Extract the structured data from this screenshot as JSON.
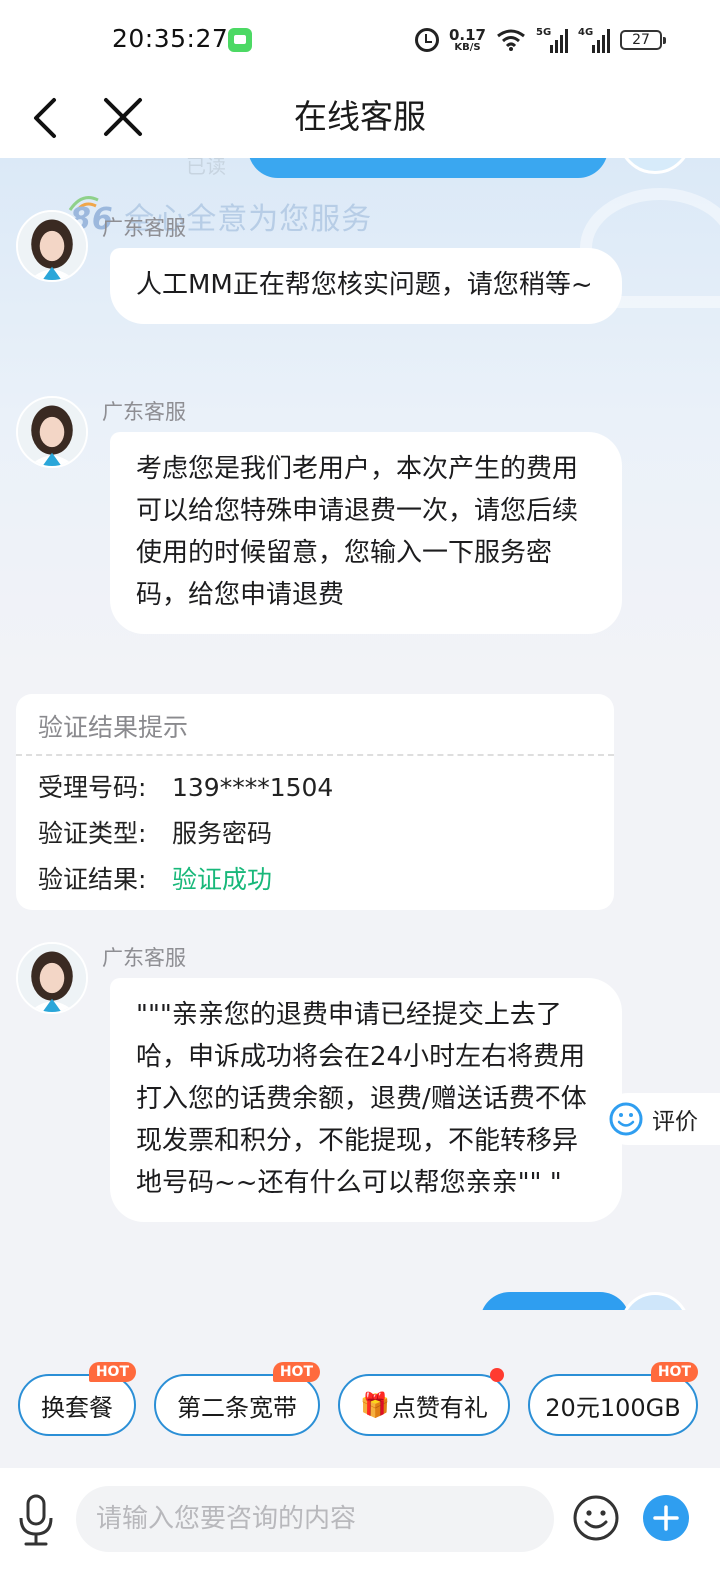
{
  "status_bar": {
    "time": "20:35:27",
    "net_speed_value": "0.17",
    "net_speed_unit": "KB/S",
    "sim1": "5G",
    "sim2": "4G",
    "battery": "27"
  },
  "header": {
    "title": "在线客服"
  },
  "chat": {
    "banner_number": "86",
    "banner_text": "全心全意为您服务",
    "prev_status": "已读",
    "messages": [
      {
        "sender": "广东客服",
        "text": "人工MM正在帮您核实问题，请您稍等~"
      },
      {
        "sender": "广东客服",
        "text": "考虑您是我们老用户，本次产生的费用可以给您特殊申请退费一次，请您后续使用的时候留意，您输入一下服务密码，给您申请退费"
      },
      {
        "sender": "广东客服",
        "text": "\"\"\"亲亲您的退费申请已经提交上去了哈，申诉成功将会在24小时左右将费用打入您的话费余额，退费/赠送话费不体现发票和积分，不能提现，不能转移异地号码~~还有什么可以帮您亲亲\"\"  \""
      }
    ],
    "verify_card": {
      "title": "验证结果提示",
      "rows": [
        {
          "key": "受理号码:",
          "value": "139****1504"
        },
        {
          "key": "验证类型:",
          "value": "服务密码"
        },
        {
          "key": "验证结果:",
          "value": "验证成功"
        }
      ]
    },
    "rate_label": "评价"
  },
  "quick_actions": [
    {
      "label": "换套餐",
      "badge": "HOT"
    },
    {
      "label": "第二条宽带",
      "badge": "HOT"
    },
    {
      "label": "点赞有礼",
      "badge": ""
    },
    {
      "label": "20元100GB",
      "badge": "HOT"
    }
  ],
  "input": {
    "placeholder": "请输入您要咨询的内容"
  },
  "colors": {
    "accent": "#2f9ef0",
    "success": "#18b87a",
    "hot": "#ff6a3d",
    "chip_border": "#2b8fd6"
  }
}
